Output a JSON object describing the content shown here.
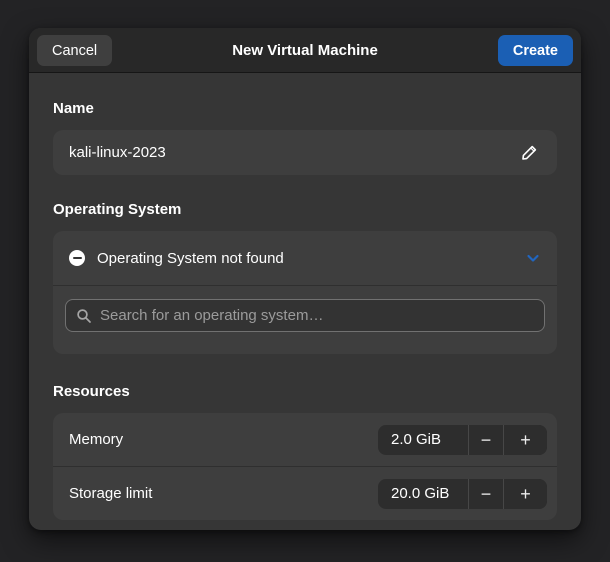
{
  "header": {
    "title": "New Virtual Machine",
    "cancel_label": "Cancel",
    "create_label": "Create"
  },
  "name_section": {
    "label": "Name",
    "value": "kali-linux-2023"
  },
  "os_section": {
    "label": "Operating System",
    "status": "Operating System not found",
    "search_placeholder": "Search for an operating system…"
  },
  "resources_section": {
    "label": "Resources",
    "rows": [
      {
        "label": "Memory",
        "value": "2.0 GiB"
      },
      {
        "label": "Storage limit",
        "value": "20.0 GiB"
      }
    ]
  },
  "icons": {
    "edit": "pencil",
    "os_status": "minus-circle",
    "dropdown": "chevron-down",
    "search": "magnifier",
    "decrement_glyph": "−",
    "increment_glyph": "+"
  },
  "colors": {
    "accent": "#1b5fb4",
    "chevron": "#2166c0",
    "dialog_bg": "#363636",
    "header_bg": "#282828",
    "card_bg": "#3e3e3e",
    "backdrop": "#232325"
  }
}
